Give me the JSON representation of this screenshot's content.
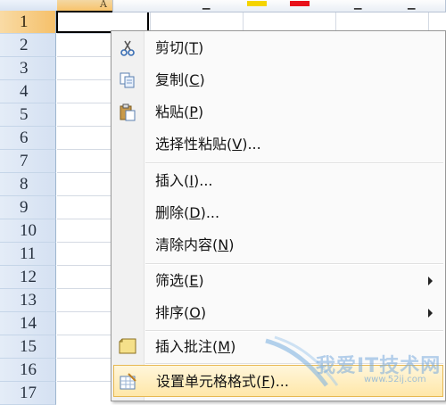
{
  "sheet": {
    "column_header": "A",
    "rows": [
      "1",
      "2",
      "3",
      "4",
      "5",
      "6",
      "7",
      "8",
      "9",
      "10",
      "11",
      "12",
      "13",
      "14",
      "15",
      "16",
      "17"
    ],
    "active_row": "1"
  },
  "toolbar": {
    "swatches": [
      "#f5d400",
      "#e8101a"
    ]
  },
  "menu": {
    "items": [
      {
        "label": "剪切",
        "key": "T",
        "icon": "scissors-icon"
      },
      {
        "label": "复制",
        "key": "C",
        "icon": "copy-icon"
      },
      {
        "label": "粘贴",
        "key": "P",
        "icon": "paste-icon"
      },
      {
        "label": "选择性粘贴",
        "key": "V",
        "suffix": "..."
      },
      {
        "label": "插入",
        "key": "I",
        "suffix": "..."
      },
      {
        "label": "删除",
        "key": "D",
        "suffix": "..."
      },
      {
        "label": "清除内容",
        "key": "N"
      },
      {
        "label": "筛选",
        "key": "E",
        "submenu": true
      },
      {
        "label": "排序",
        "key": "O",
        "submenu": true
      },
      {
        "label": "插入批注",
        "key": "M",
        "icon": "comment-icon"
      },
      {
        "label": "设置单元格格式",
        "key": "F",
        "suffix": "...",
        "icon": "format-cells-icon",
        "highlighted": true
      }
    ]
  },
  "watermark": {
    "text": "我爱IT技术网",
    "url": "www.52ij.com"
  },
  "colors": {
    "highlight": "#ffe7a8",
    "active_header": "#f8c36b"
  }
}
